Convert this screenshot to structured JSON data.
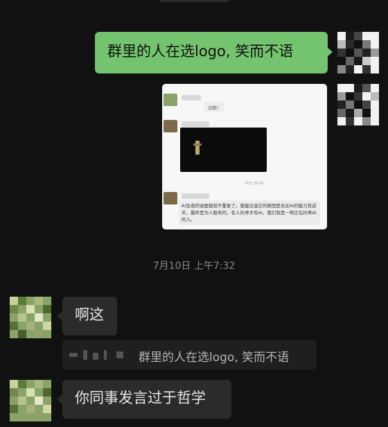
{
  "chat": {
    "outgoing_message": "群里的人在选logo, 笑而不语",
    "timestamp": "7月10日 上午7:32",
    "reply_1": "啊这",
    "quote_text": "群里的人在选logo, 笑而不语",
    "reply_2": "你同事发言过于哲学"
  },
  "shared_image": {
    "question_fragment": "议题?",
    "time_label": "昨天 20:08",
    "message_text": "AI生成的谜面我就不重复了。我建议选它的原因是无论AI的能力有逆天，最终是为人服务的，有人托举才有AI，我们就是一帮正在托举AI的人。"
  },
  "colors": {
    "background": "#111111",
    "outgoing_bubble": "#74c36e",
    "incoming_bubble": "#2b2b2b",
    "timestamp_text": "#8a8a8a"
  }
}
